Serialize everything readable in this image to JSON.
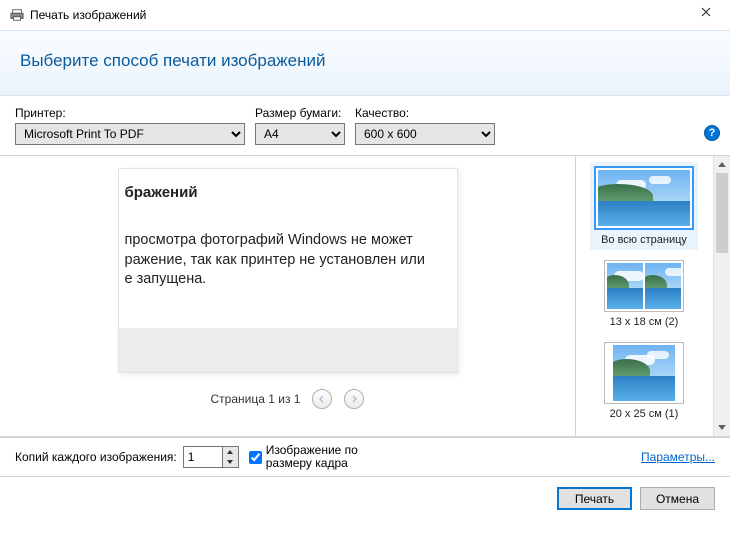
{
  "window": {
    "title": "Печать изображений"
  },
  "banner": {
    "heading": "Выберите способ печати изображений"
  },
  "fields": {
    "printer_label": "Принтер:",
    "printer_value": "Microsoft Print To PDF",
    "paper_label": "Размер бумаги:",
    "paper_value": "A4",
    "quality_label": "Качество:",
    "quality_value": "600 x 600"
  },
  "preview": {
    "title_fragment": "бражений",
    "body_line1": "  просмотра фотографий Windows не может",
    "body_line2": "ражение, так как принтер не установлен или",
    "body_line3": "е запущена."
  },
  "page_nav": {
    "counter": "Страница 1 из 1"
  },
  "layouts": {
    "item0": "Во всю страницу",
    "item1": "13 x 18 см (2)",
    "item2": "20 x 25 см (1)"
  },
  "bottom": {
    "copies_label": "Копий каждого изображения:",
    "copies_value": "1",
    "fit_label": "Изображение по размеру кадра",
    "options_link": "Параметры..."
  },
  "footer": {
    "print": "Печать",
    "cancel": "Отмена"
  }
}
